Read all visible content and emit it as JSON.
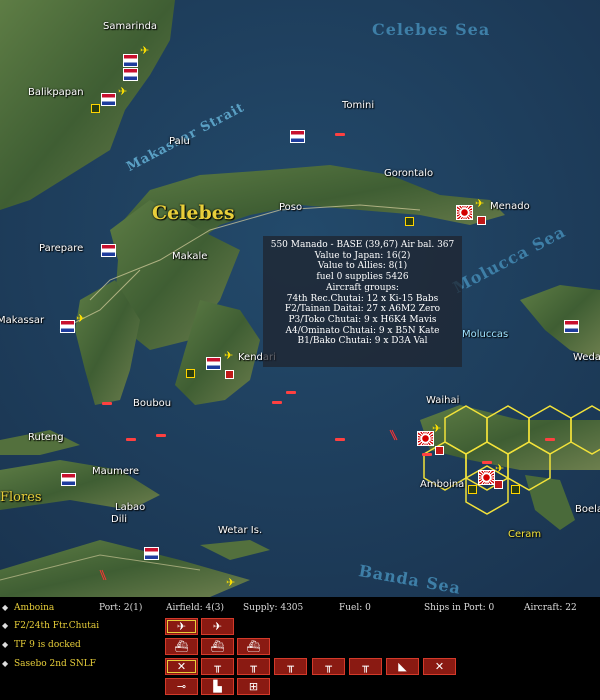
{
  "map": {
    "region_label": "Celebes",
    "sea_labels": {
      "celebes": "Celebes Sea",
      "molucca": "Molucca Sea",
      "banda": "Banda Sea",
      "makassar": "Makassar Strait"
    },
    "places": {
      "samarinda": "Samarinda",
      "balikpapan": "Balikpapan",
      "tomini": "Tomini",
      "palu": "Palu",
      "gorontalo": "Gorontalo",
      "menado": "Menado",
      "poso": "Poso",
      "parepare": "Parepare",
      "makale": "Makale",
      "makassar": "Makassar",
      "kendari": "Kendari",
      "moluccas": "Moluccas",
      "weda": "Weda",
      "boubou": "Boubou",
      "waihai": "Waihai",
      "ruteng": "Ruteng",
      "maumere": "Maumere",
      "flores": "Flores",
      "labao": "Labao",
      "ambon": "Amboina",
      "boela": "Boela",
      "ceram": "Ceram",
      "wetar": "Wetar Is.",
      "dili": "Dili"
    }
  },
  "tooltip": {
    "lines": [
      "550 Manado - BASE (39,67) Air bal. 367",
      "Value to Japan: 16(2)",
      "Value to Allies: 8(1)",
      "fuel 0  supplies 5426",
      "Aircraft groups:",
      "74th Rec.Chutai: 12 x Ki-15 Babs",
      "F2/Tainan Daitai: 27 x A6M2 Zero",
      "P3/Toko Chutai: 9 x H6K4 Mavis",
      "A4/Ominato Chutai: 9 x B5N Kate",
      "B1/Bako Chutai: 9 x D3A Val"
    ]
  },
  "panel": {
    "base_name": "Amboina",
    "port": "Port: 2(1)",
    "airfield": "Airfield: 4(3)",
    "supply": "Supply: 4305",
    "fuel": "Fuel: 0",
    "ships_in_port": "Ships in Port: 0",
    "aircraft": "Aircraft: 22",
    "units": [
      "F2/24th Ftr.Chutai",
      "TF 9 is docked",
      "Sasebo 2nd SNLF"
    ],
    "bullet": "◆",
    "button_icons": [
      "fighter-icon",
      "bomber-icon",
      "warship-icon",
      "cargo-ship-icon",
      "tanker-icon",
      "infantry-icon",
      "hq-icon",
      "building-icon",
      "artillery-icon",
      "rifle-icon",
      "factory-icon",
      "repair-icon"
    ]
  },
  "colors": {
    "sea": "#1f3d5c",
    "land": "#4d6b3a",
    "panel_text": "#e8cf3a",
    "button": "#8a1a12"
  }
}
